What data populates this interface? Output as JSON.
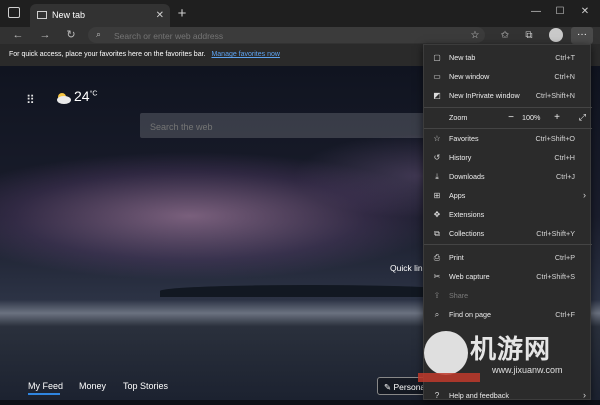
{
  "browser": {
    "tab_title": "New tab",
    "tab_close": "✕",
    "new_tab_button": "+",
    "window_controls": [
      "—",
      "☐",
      "✕"
    ],
    "address_placeholder": "Search or enter web address",
    "more_button": "···"
  },
  "favorites_bar": {
    "text": "For quick access, place your favorites here on the favorites bar.",
    "link": "Manage favorites now"
  },
  "newtab_page": {
    "temperature": "24",
    "temp_unit": "°C",
    "search_placeholder": "Search the web",
    "quick_links": "Quick link",
    "feed_tabs": [
      "My Feed",
      "Money",
      "Top Stories"
    ],
    "personalize": "✎ Persona"
  },
  "menu": {
    "items": [
      {
        "label": "New tab",
        "shortcut": "Ctrl+T",
        "icon": "new-tab-icon"
      },
      {
        "label": "New window",
        "shortcut": "Ctrl+N",
        "icon": "window-icon"
      },
      {
        "label": "New InPrivate window",
        "shortcut": "Ctrl+Shift+N",
        "icon": "inprivate-icon"
      },
      {
        "label": "Zoom",
        "icon": "zoom-icon"
      },
      {
        "label": "Favorites",
        "shortcut": "Ctrl+Shift+O",
        "icon": "star-icon"
      },
      {
        "label": "History",
        "shortcut": "Ctrl+H",
        "icon": "history-icon"
      },
      {
        "label": "Downloads",
        "shortcut": "Ctrl+J",
        "icon": "download-icon"
      },
      {
        "label": "Apps",
        "icon": "apps-icon"
      },
      {
        "label": "Extensions",
        "icon": "extensions-icon"
      },
      {
        "label": "Collections",
        "shortcut": "Ctrl+Shift+Y",
        "icon": "collections-icon"
      },
      {
        "label": "Print",
        "shortcut": "Ctrl+P",
        "icon": "print-icon"
      },
      {
        "label": "Web capture",
        "shortcut": "Ctrl+Shift+S",
        "icon": "capture-icon"
      },
      {
        "label": "Share",
        "icon": "share-icon"
      },
      {
        "label": "Find on page",
        "shortcut": "Ctrl+F",
        "icon": "find-icon"
      },
      {
        "label": "Help and feedback",
        "icon": "help-icon"
      }
    ],
    "zoom_value": "100%"
  },
  "watermark": {
    "text": "机游网",
    "url": "www.jixuanw.com"
  },
  "colors": {
    "accent": "#2f85e0",
    "link": "#5ea3f0",
    "menu_bg": "#2b2b2b"
  }
}
